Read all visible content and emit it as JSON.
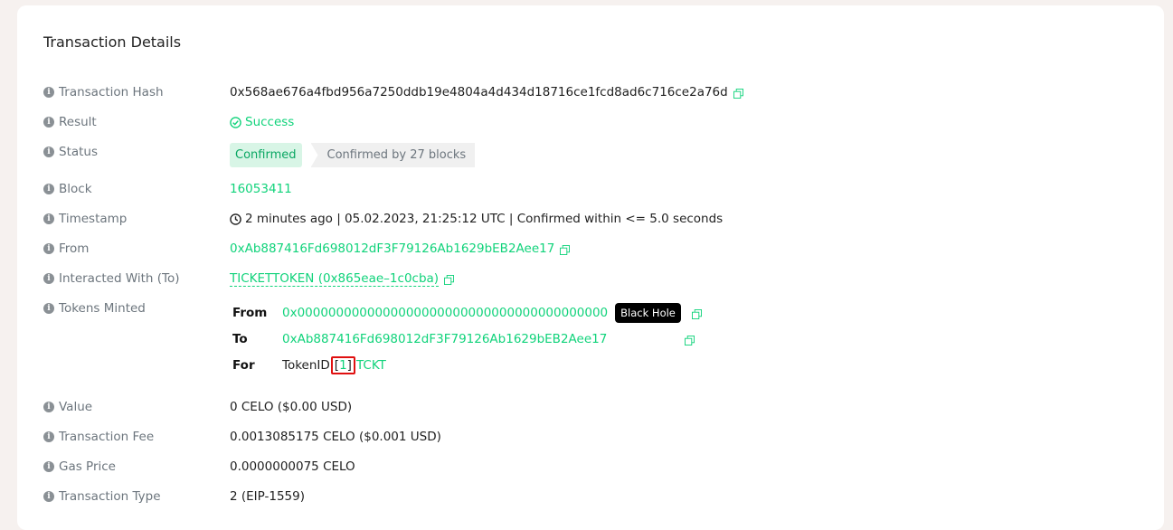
{
  "title": "Transaction Details",
  "labels": {
    "hash": "Transaction Hash",
    "result": "Result",
    "status": "Status",
    "block": "Block",
    "timestamp": "Timestamp",
    "from": "From",
    "to": "Interacted With (To)",
    "minted": "Tokens Minted",
    "value": "Value",
    "fee": "Transaction Fee",
    "gas": "Gas Price",
    "type": "Transaction Type"
  },
  "values": {
    "hash": "0x568ae676a4fbd956a7250ddb19e4804a4d434d18716ce1fcd8ad6c716ce2a76d",
    "result": "Success",
    "status_badge": "Confirmed",
    "status_blocks": "Confirmed by 27 blocks",
    "block": "16053411",
    "timestamp": "2 minutes ago | 05.02.2023, 21:25:12 UTC | Confirmed within <= 5.0 seconds",
    "from": "0xAb887416Fd698012dF3F79126Ab1629bEB2Aee17",
    "to": "TICKETTOKEN (0x865eae–1c0cba)",
    "value": "0 CELO ($0.00 USD)",
    "fee": "0.0013085175 CELO ($0.001 USD)",
    "gas": "0.0000000075 CELO",
    "type": "2 (EIP-1559)"
  },
  "minted": {
    "from_key": "From",
    "from_addr": "0x0000000000000000000000000000000000000000",
    "from_tag": "Black Hole",
    "to_key": "To",
    "to_addr": "0xAb887416Fd698012dF3F79126Ab1629bEB2Aee17",
    "for_key": "For",
    "token_prefix": "TokenID",
    "token_open": "[",
    "token_id": "1",
    "token_close": "]",
    "token_symbol": "TCKT"
  },
  "colors": {
    "accent": "#11d37b",
    "highlight": "#e01010"
  },
  "icons": {
    "info": "info-circle-icon",
    "copy": "copy-icon",
    "success": "check-circle-icon",
    "clock": "clock-icon"
  }
}
